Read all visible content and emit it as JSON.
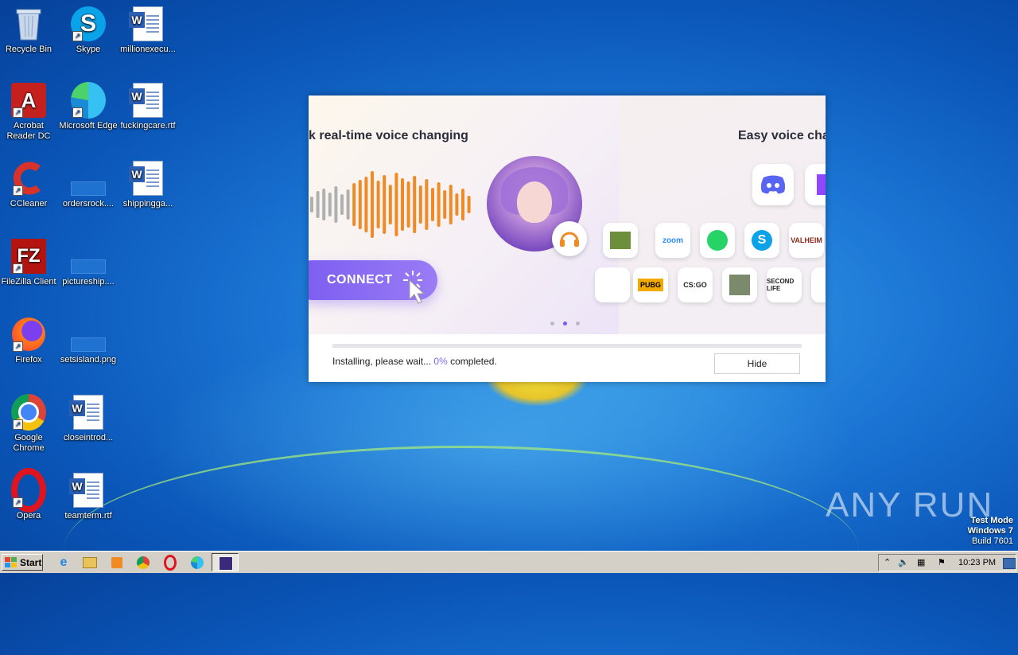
{
  "desktop": {
    "icons": [
      {
        "label": "Recycle Bin",
        "icon": "recycle-bin-icon"
      },
      {
        "label": "Skype",
        "icon": "skype-icon"
      },
      {
        "label": "millionexecu...",
        "icon": "word-doc-icon"
      },
      {
        "label": "Acrobat Reader DC",
        "icon": "acrobat-icon"
      },
      {
        "label": "Microsoft Edge",
        "icon": "edge-icon"
      },
      {
        "label": "fuckingcare.rtf",
        "icon": "word-doc-icon"
      },
      {
        "label": "CCleaner",
        "icon": "ccleaner-icon"
      },
      {
        "label": "ordersrock....",
        "icon": "file-icon"
      },
      {
        "label": "shippingga...",
        "icon": "word-doc-icon"
      },
      {
        "label": "FileZilla Client",
        "icon": "filezilla-icon"
      },
      {
        "label": "pictureship....",
        "icon": "file-icon"
      },
      {
        "label": "Firefox",
        "icon": "firefox-icon"
      },
      {
        "label": "setsisland.png",
        "icon": "image-file-icon"
      },
      {
        "label": "Google Chrome",
        "icon": "chrome-icon"
      },
      {
        "label": "closeintrod...",
        "icon": "word-doc-icon"
      },
      {
        "label": "Opera",
        "icon": "opera-icon"
      },
      {
        "label": "teamterm.rtf",
        "icon": "word-doc-icon"
      }
    ]
  },
  "installer": {
    "slide1_title": "k real-time voice changing",
    "slide2_title": "Easy voice cha",
    "connect_label": "CONNECT",
    "progress_fraction": 0.0,
    "status_prefix": "Installing, please wait...",
    "status_percent": "0%",
    "status_suffix": "completed.",
    "hide_label": "Hide",
    "slide_dots": 3,
    "active_dot": 1,
    "apps": [
      "discord",
      "twitch",
      "minecraft",
      "zoom",
      "whatsapp",
      "skype",
      "valheim",
      "pubg",
      "csgo",
      "gta",
      "second life"
    ],
    "app_labels": {
      "zoom": "zoom",
      "valheim": "VALHEIM",
      "pubg": "PUBG",
      "csgo": "CS:GO",
      "second_life": "SECOND LIFE"
    },
    "colors": {
      "accent": "#7b5cf0",
      "wave_orange": "#f08a24",
      "wave_gray": "#b0b0b0"
    }
  },
  "watermark": {
    "text": "ANY RUN",
    "testmode_line1": "Test Mode",
    "testmode_line2": "Windows 7",
    "testmode_line3": "Build 7601"
  },
  "taskbar": {
    "start_label": "Start",
    "clock": "10:23 PM"
  }
}
